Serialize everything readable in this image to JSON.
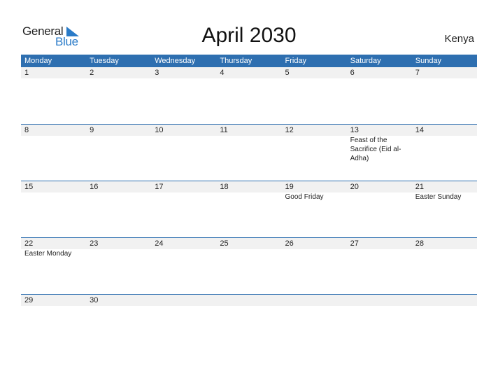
{
  "logo": {
    "word1": "General",
    "word2": "Blue"
  },
  "title": "April 2030",
  "country": "Kenya",
  "colors": {
    "accent": "#2e6fb0",
    "logo_blue": "#2a7bc8",
    "date_bar": "#f1f1f1"
  },
  "weekdays": [
    "Monday",
    "Tuesday",
    "Wednesday",
    "Thursday",
    "Friday",
    "Saturday",
    "Sunday"
  ],
  "weeks": [
    {
      "days": [
        "1",
        "2",
        "3",
        "4",
        "5",
        "6",
        "7"
      ],
      "events": [
        "",
        "",
        "",
        "",
        "",
        "",
        ""
      ]
    },
    {
      "days": [
        "8",
        "9",
        "10",
        "11",
        "12",
        "13",
        "14"
      ],
      "events": [
        "",
        "",
        "",
        "",
        "",
        "Feast of the Sacrifice (Eid al-Adha)",
        ""
      ]
    },
    {
      "days": [
        "15",
        "16",
        "17",
        "18",
        "19",
        "20",
        "21"
      ],
      "events": [
        "",
        "",
        "",
        "",
        "Good Friday",
        "",
        "Easter Sunday"
      ]
    },
    {
      "days": [
        "22",
        "23",
        "24",
        "25",
        "26",
        "27",
        "28"
      ],
      "events": [
        "Easter Monday",
        "",
        "",
        "",
        "",
        "",
        ""
      ]
    },
    {
      "days": [
        "29",
        "30",
        "",
        "",
        "",
        "",
        ""
      ],
      "events": [
        "",
        "",
        "",
        "",
        "",
        "",
        ""
      ]
    }
  ]
}
